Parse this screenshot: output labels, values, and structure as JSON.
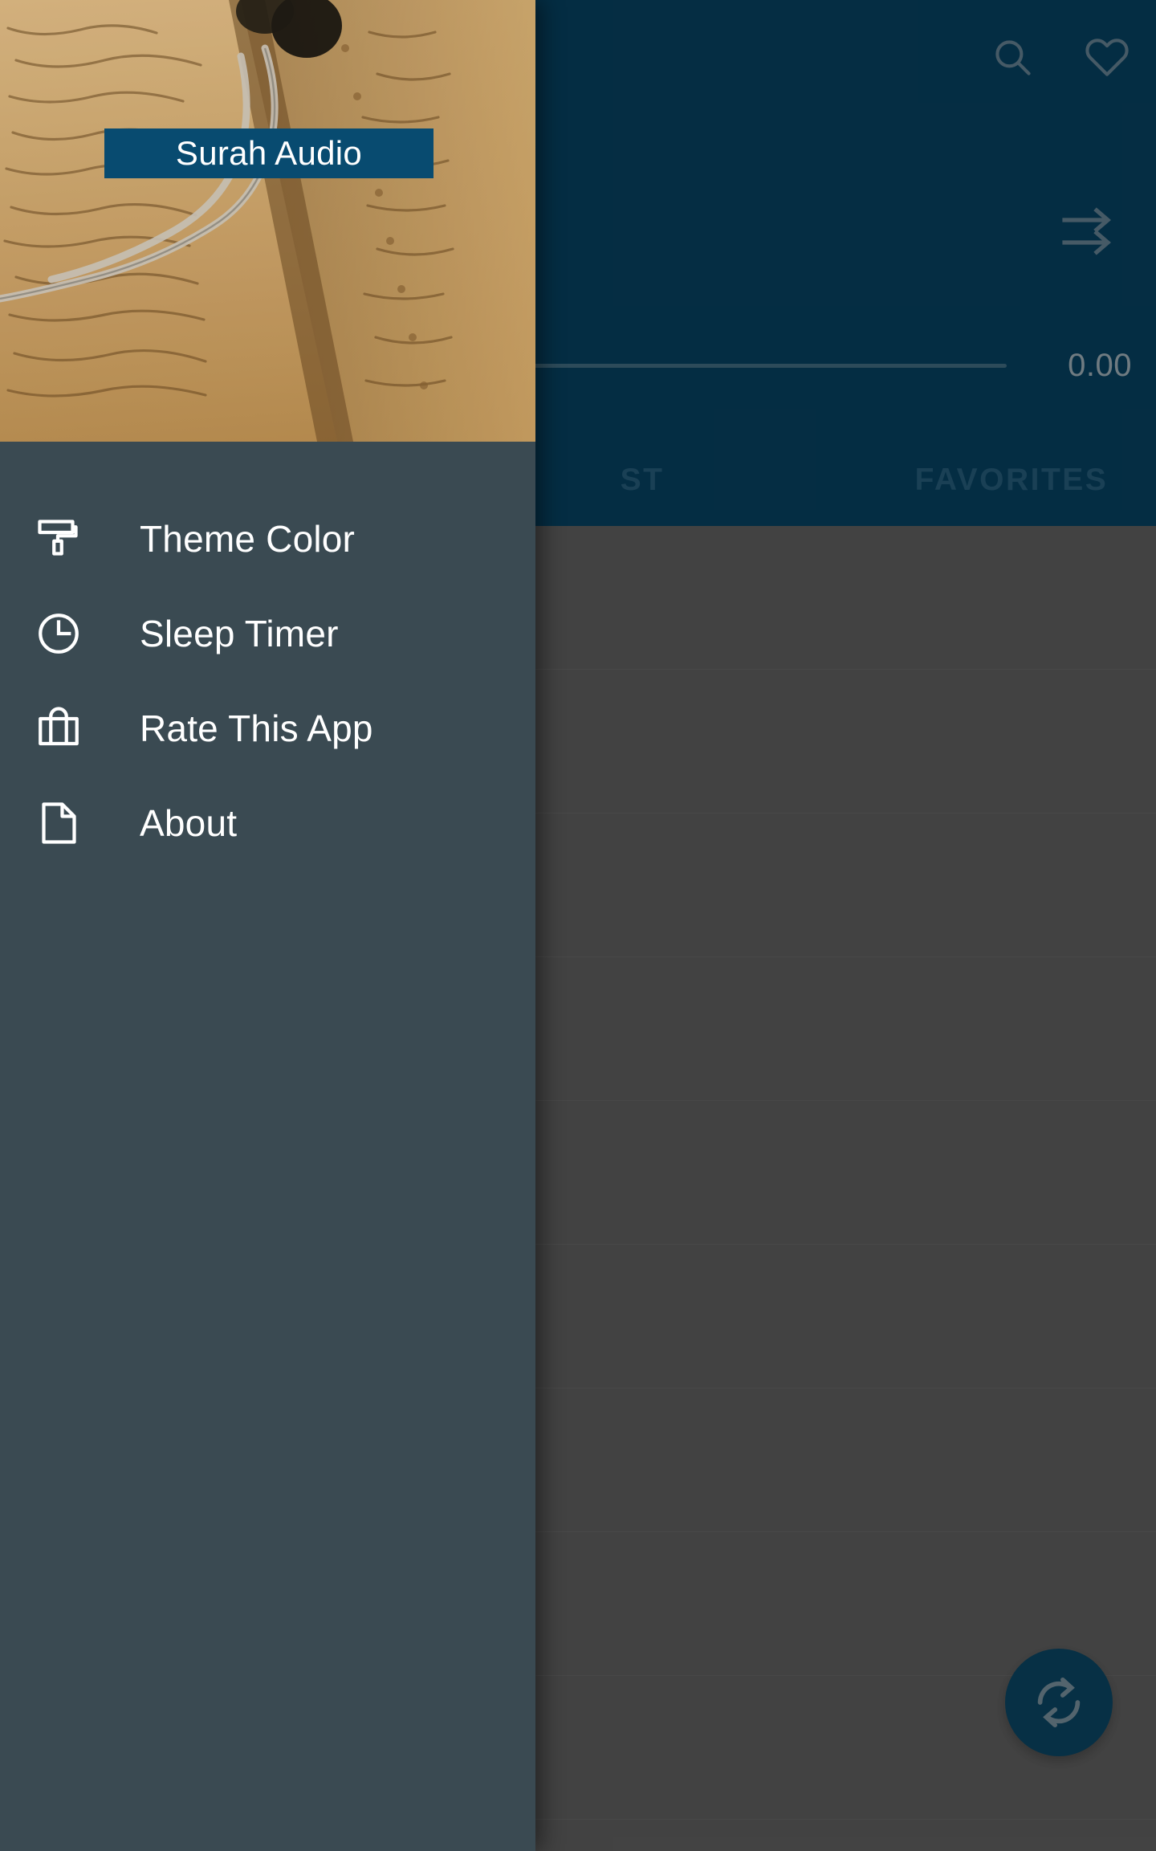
{
  "app": {
    "title": "Surah Audio",
    "accent_blue": "#084b70",
    "drawer_bg": "#3a4a52",
    "scrim_gray": "#6f6f6f"
  },
  "appbar": {
    "search_icon": "search-icon",
    "favorite_icon": "heart-icon",
    "skip_icon": "skip-next-double-arrow-icon",
    "time_label": "0.00",
    "progress_percent": 0
  },
  "tabs": [
    {
      "label": "",
      "selected": false
    },
    {
      "label": "ST",
      "selected": false
    },
    {
      "label": "FAVORITES",
      "selected": false
    }
  ],
  "fab": {
    "icon": "refresh-sync-icon",
    "label": "Refresh"
  },
  "drawer": {
    "header_title": "Surah Audio",
    "items": [
      {
        "label": "Theme Color",
        "icon": "paint-roller-icon"
      },
      {
        "label": "Sleep Timer",
        "icon": "clock-icon"
      },
      {
        "label": "Rate This App",
        "icon": "shopping-bag-icon"
      },
      {
        "label": "About",
        "icon": "document-icon"
      }
    ]
  },
  "list": {
    "rows": [
      "",
      "",
      "",
      "",
      "",
      "",
      "",
      "",
      ""
    ]
  }
}
